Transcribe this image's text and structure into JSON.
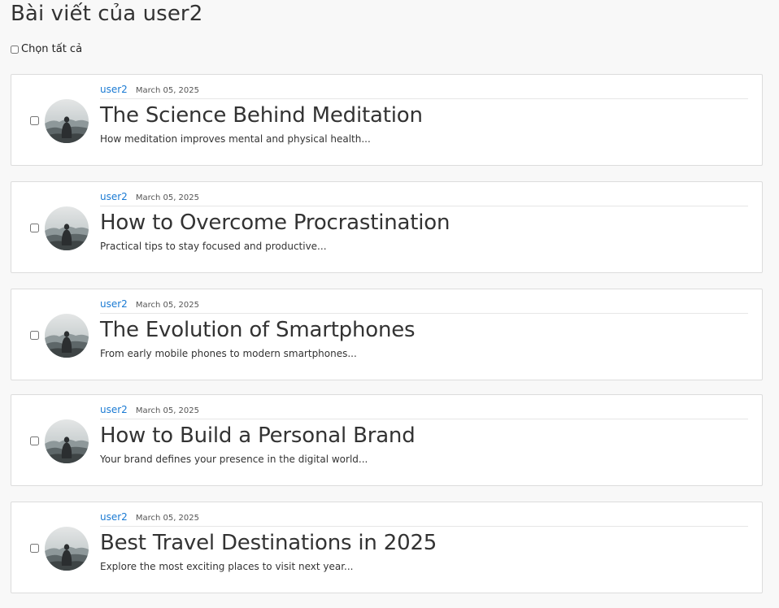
{
  "page": {
    "title": "Bài viết của user2",
    "select_all_label": "Chọn tất cả"
  },
  "posts": [
    {
      "author": "user2",
      "date": "March 05, 2025",
      "title": "The Science Behind Meditation",
      "excerpt": "How meditation improves mental and physical health..."
    },
    {
      "author": "user2",
      "date": "March 05, 2025",
      "title": "How to Overcome Procrastination",
      "excerpt": "Practical tips to stay focused and productive..."
    },
    {
      "author": "user2",
      "date": "March 05, 2025",
      "title": "The Evolution of Smartphones",
      "excerpt": "From early mobile phones to modern smartphones..."
    },
    {
      "author": "user2",
      "date": "March 05, 2025",
      "title": "How to Build a Personal Brand",
      "excerpt": "Your brand defines your presence in the digital world..."
    },
    {
      "author": "user2",
      "date": "March 05, 2025",
      "title": "Best Travel Destinations in 2025",
      "excerpt": "Explore the most exciting places to visit next year..."
    }
  ],
  "colors": {
    "link": "#1a7ad3",
    "text": "#333333",
    "background": "#f8f8f8",
    "card_border": "#dcdcdc"
  }
}
